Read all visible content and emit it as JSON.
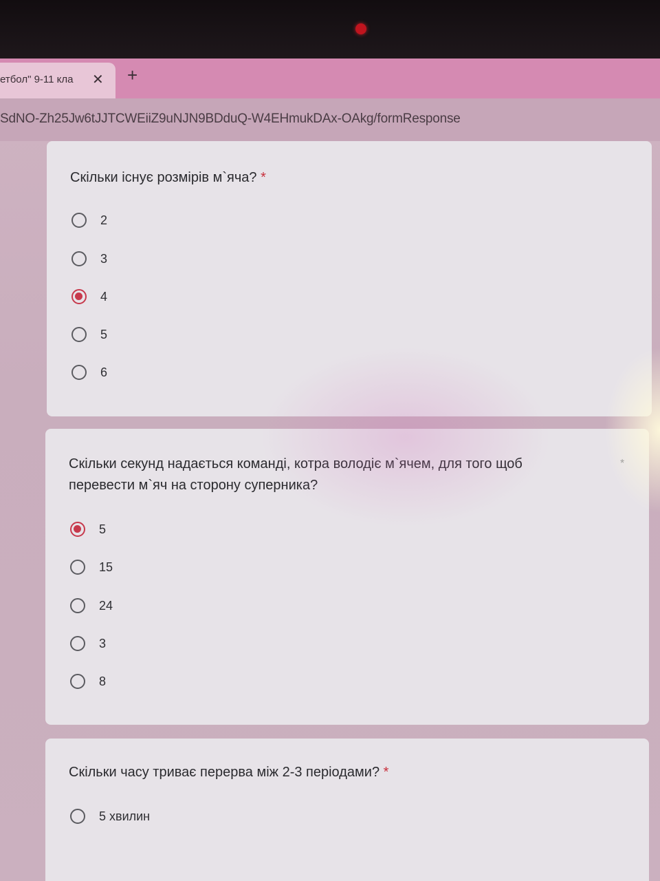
{
  "browser": {
    "tab_title": "етбол\" 9-11 кла",
    "tab_close": "✕",
    "new_tab": "+",
    "url": "SdNO-Zh25Jw6tJJTCWEiiZ9uNJN9BDduQ-W4EHmukDAx-OAkg/formResponse"
  },
  "form": {
    "required_marker": "*",
    "questions": [
      {
        "text": "Скільки існує розмірів  м`яча?",
        "options": [
          "2",
          "3",
          "4",
          "5",
          "6"
        ],
        "selected": "4"
      },
      {
        "text_line1": "Скільки секунд надається команді, котра володіє м`ячем, для того щоб",
        "text_line2": "перевести  м`яч на сторону суперника?",
        "options": [
          "5",
          "15",
          "24",
          "3",
          "8"
        ],
        "selected": "5"
      },
      {
        "text": "Скільки часу триває перерва між 2-3 періодами?",
        "options": [
          "5 хвилин"
        ],
        "selected": null
      }
    ]
  },
  "colors": {
    "accent": "#c7394c",
    "tab_bar": "#d58ab2",
    "card": "#e7e3e8"
  }
}
